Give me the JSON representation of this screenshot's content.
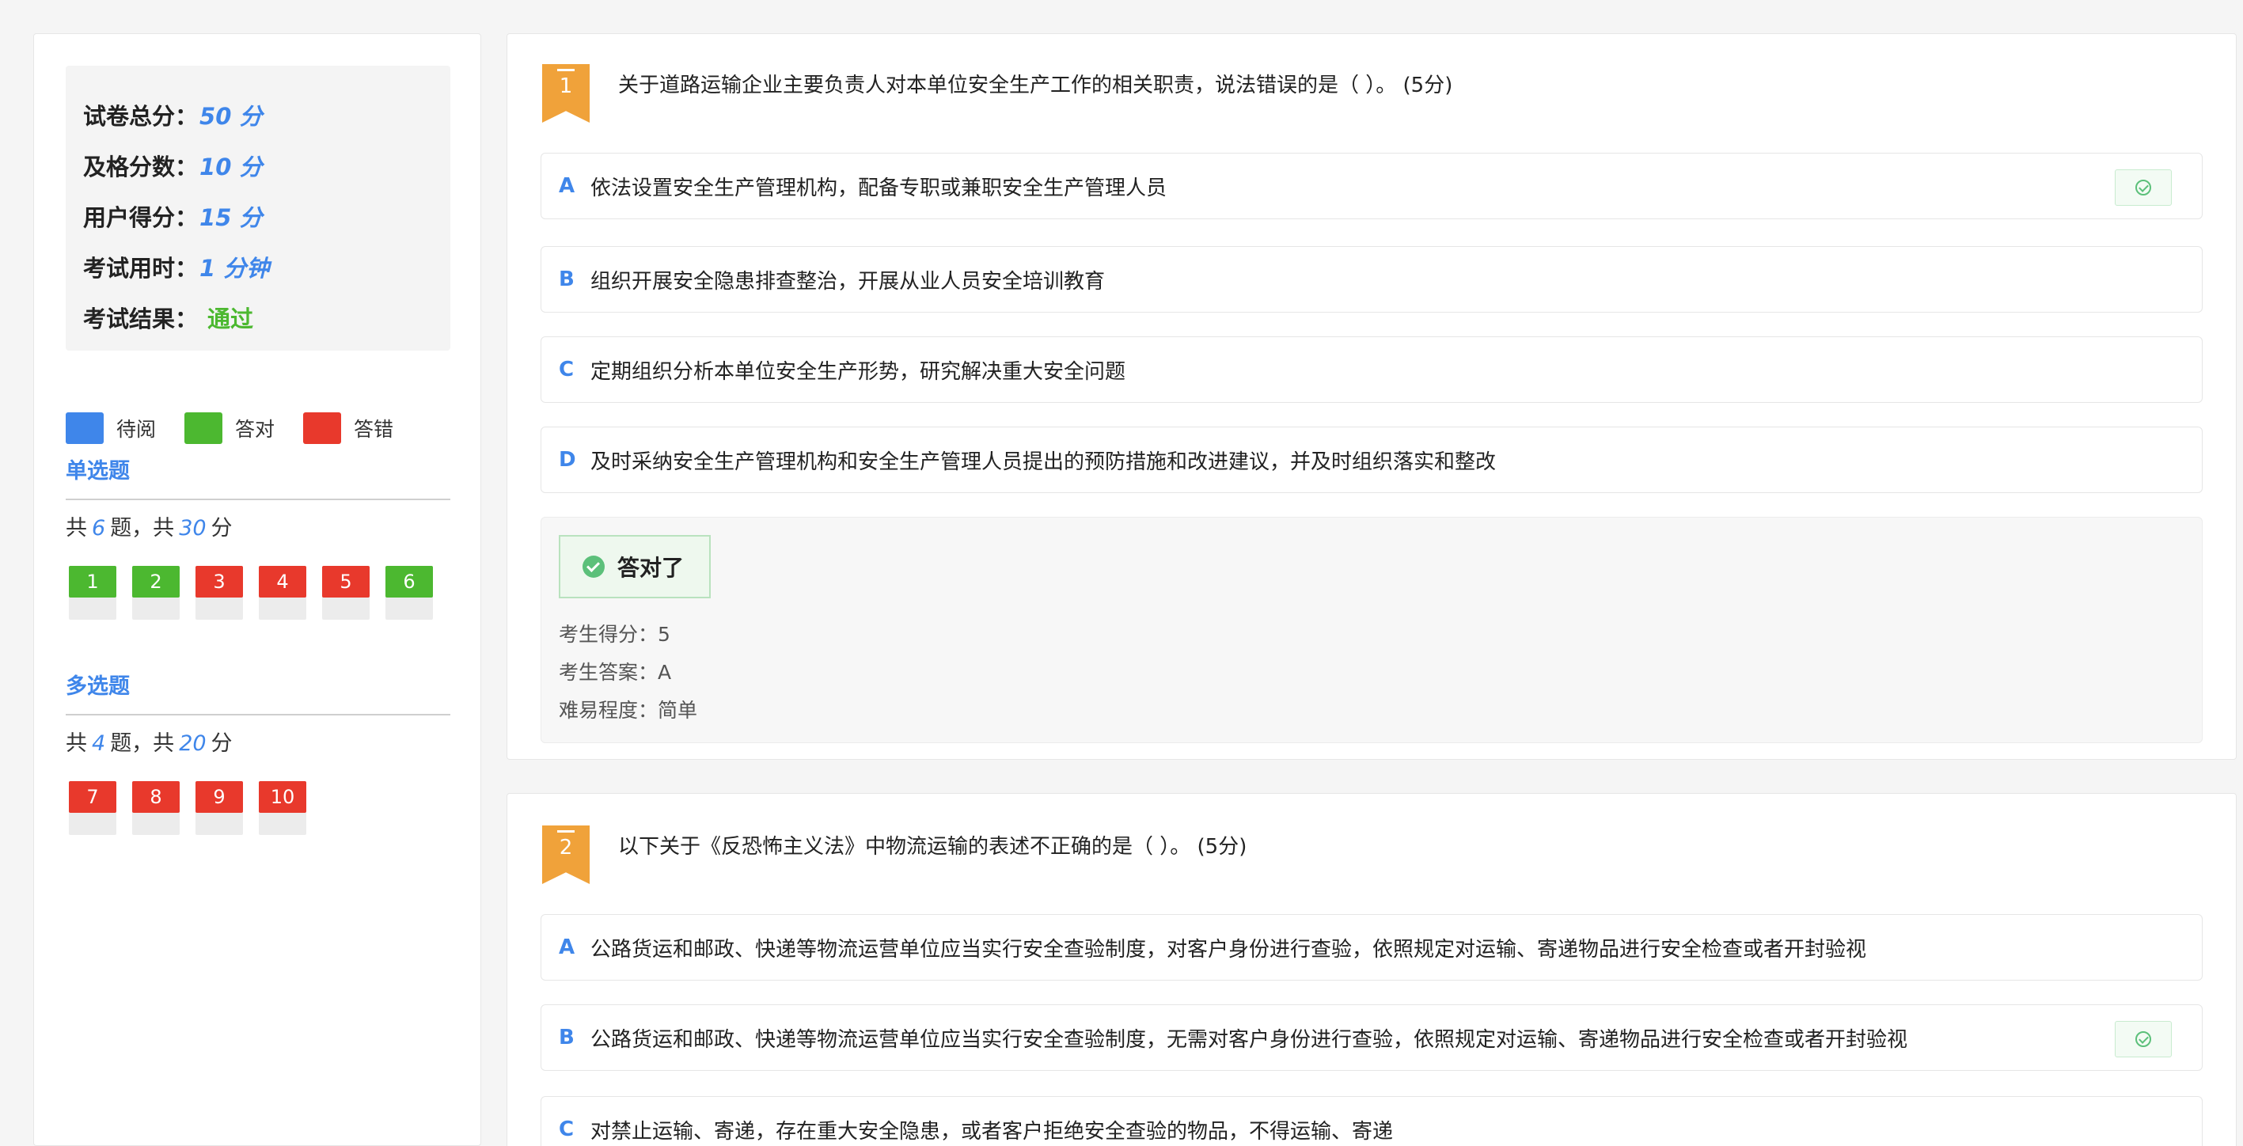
{
  "summary": {
    "total_label": "试卷总分：",
    "total_value": "50 分",
    "pass_label": "及格分数：",
    "pass_value": "10 分",
    "score_label": "用户得分：",
    "score_value": "15 分",
    "time_label": "考试用时：",
    "time_value": "1 分钟",
    "result_label": "考试结果：",
    "result_value": "通过"
  },
  "legend": {
    "pending": "待阅",
    "correct": "答对",
    "wrong": "答错"
  },
  "colors": {
    "pending": "#3f86ea",
    "correct": "#4cb830",
    "wrong": "#e8392c",
    "accent": "#3f86ea",
    "bookmark": "#f0a23a"
  },
  "single": {
    "title": "单选题",
    "info_prefix": "共",
    "count": "6",
    "info_mid": "题，共",
    "points": "30",
    "info_suffix": "分",
    "items": [
      {
        "num": "1",
        "status": "correct"
      },
      {
        "num": "2",
        "status": "correct"
      },
      {
        "num": "3",
        "status": "wrong"
      },
      {
        "num": "4",
        "status": "wrong"
      },
      {
        "num": "5",
        "status": "wrong"
      },
      {
        "num": "6",
        "status": "correct"
      }
    ]
  },
  "multi": {
    "title": "多选题",
    "info_prefix": "共",
    "count": "4",
    "info_mid": "题，共",
    "points": "20",
    "info_suffix": "分",
    "items": [
      {
        "num": "7",
        "status": "wrong"
      },
      {
        "num": "8",
        "status": "wrong"
      },
      {
        "num": "9",
        "status": "wrong"
      },
      {
        "num": "10",
        "status": "wrong"
      }
    ]
  },
  "questions": [
    {
      "num": "1",
      "text": "关于道路运输企业主要负责人对本单位安全生产工作的相关职责，说法错误的是（ ）。 (5分)",
      "options": [
        {
          "letter": "A",
          "text": "依法设置安全生产管理机构，配备专职或兼职安全生产管理人员",
          "marked": true
        },
        {
          "letter": "B",
          "text": "组织开展安全隐患排查整治，开展从业人员安全培训教育",
          "marked": false
        },
        {
          "letter": "C",
          "text": "定期组织分析本单位安全生产形势，研究解决重大安全问题",
          "marked": false
        },
        {
          "letter": "D",
          "text": "及时采纳安全生产管理机构和安全生产管理人员提出的预防措施和改进建议，并及时组织落实和整改",
          "marked": false
        }
      ],
      "result": {
        "badge": "答对了",
        "score": "考生得分：5",
        "answer": "考生答案：A",
        "difficulty": "难易程度：简单"
      }
    },
    {
      "num": "2",
      "text": "以下关于《反恐怖主义法》中物流运输的表述不正确的是（ ）。 (5分)",
      "options": [
        {
          "letter": "A",
          "text": "公路货运和邮政、快递等物流运营单位应当实行安全查验制度，对客户身份进行查验，依照规定对运输、寄递物品进行安全检查或者开封验视",
          "marked": false
        },
        {
          "letter": "B",
          "text": "公路货运和邮政、快递等物流运营单位应当实行安全查验制度，无需对客户身份进行查验，依照规定对运输、寄递物品进行安全检查或者开封验视",
          "marked": true
        },
        {
          "letter": "C",
          "text": "对禁止运输、寄递，存在重大安全隐患，或者客户拒绝安全查验的物品，不得运输、寄递",
          "marked": false
        }
      ]
    }
  ]
}
